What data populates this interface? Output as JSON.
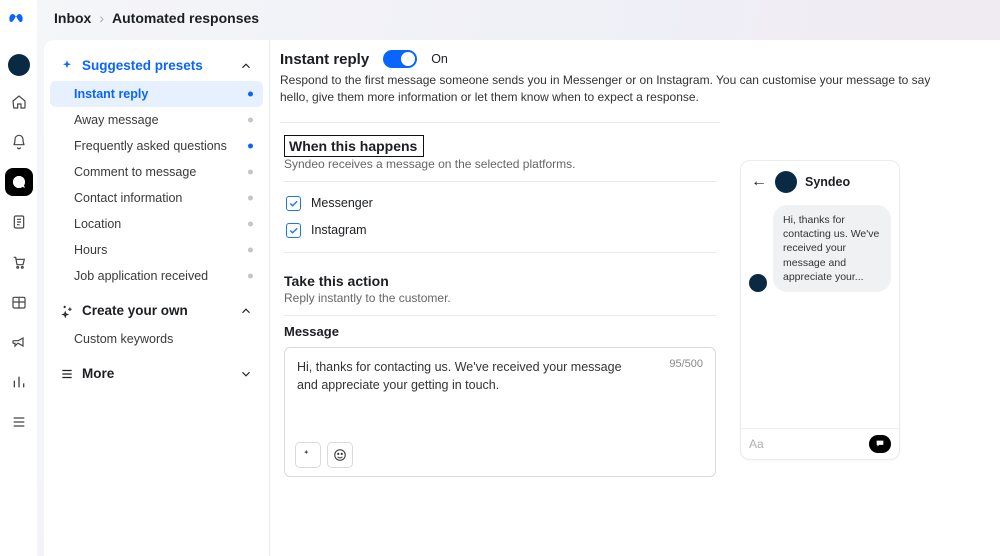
{
  "breadcrumbs": {
    "root": "Inbox",
    "current": "Automated responses"
  },
  "sidebar": {
    "presets": {
      "title": "Suggested presets",
      "items": [
        {
          "label": "Instant reply",
          "active": true,
          "dot": "blue"
        },
        {
          "label": "Away message",
          "dot": "grey"
        },
        {
          "label": "Frequently asked questions",
          "dot": "blue"
        },
        {
          "label": "Comment to message",
          "dot": "grey"
        },
        {
          "label": "Contact information",
          "dot": "grey"
        },
        {
          "label": "Location",
          "dot": "grey"
        },
        {
          "label": "Hours",
          "dot": "grey"
        },
        {
          "label": "Job application received",
          "dot": "grey"
        }
      ]
    },
    "create": {
      "title": "Create your own",
      "items": [
        {
          "label": "Custom keywords"
        }
      ]
    },
    "more": {
      "title": "More"
    }
  },
  "page": {
    "title": "Instant reply",
    "state": "On",
    "description": "Respond to the first message someone sends you in Messenger or on Instagram. You can customise your message to say hello, give them more information or let them know when to expect a response."
  },
  "when": {
    "title": "When this happens",
    "subtitle": "Syndeo receives a message on the selected platforms.",
    "platforms": [
      {
        "name": "Messenger",
        "checked": true
      },
      {
        "name": "Instagram",
        "checked": true
      }
    ]
  },
  "action": {
    "title": "Take this action",
    "subtitle": "Reply instantly to the customer.",
    "msg_label": "Message",
    "msg_text": "Hi, thanks for contacting us. We've received your message and appreciate your getting in touch.",
    "counter": "95/500"
  },
  "preview": {
    "page_name": "Syndeo",
    "bubble": "Hi, thanks for contacting us. We've received your message and appreciate your...",
    "input_placeholder": "Aa"
  }
}
